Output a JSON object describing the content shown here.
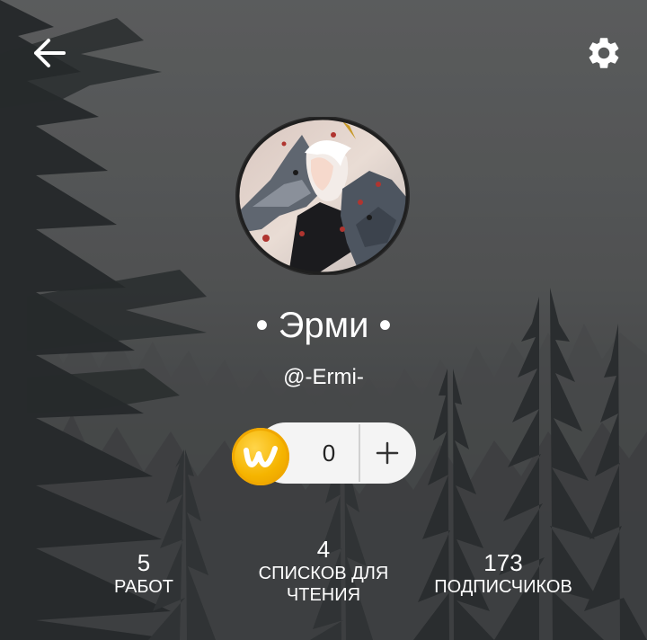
{
  "header": {
    "back_icon": "arrow-left-icon",
    "settings_icon": "gear-icon"
  },
  "profile": {
    "display_name": "• Эрми •",
    "username": "@-Ermi-",
    "avatar_alt": "wolves-avatar"
  },
  "coins": {
    "icon": "wattpad-coin-icon",
    "count": "0",
    "add_icon": "plus-icon"
  },
  "stats": [
    {
      "value": "5",
      "label": "РАБОТ"
    },
    {
      "value": "4",
      "label_line1": "СПИСКОВ ДЛЯ",
      "label_line2": "ЧТЕНИЯ"
    },
    {
      "value": "173",
      "label": "ПОДПИСЧИКОВ"
    }
  ],
  "colors": {
    "coin_gold": "#f5b400",
    "pill_bg": "#f4f4f4",
    "text_light": "#ffffff"
  }
}
